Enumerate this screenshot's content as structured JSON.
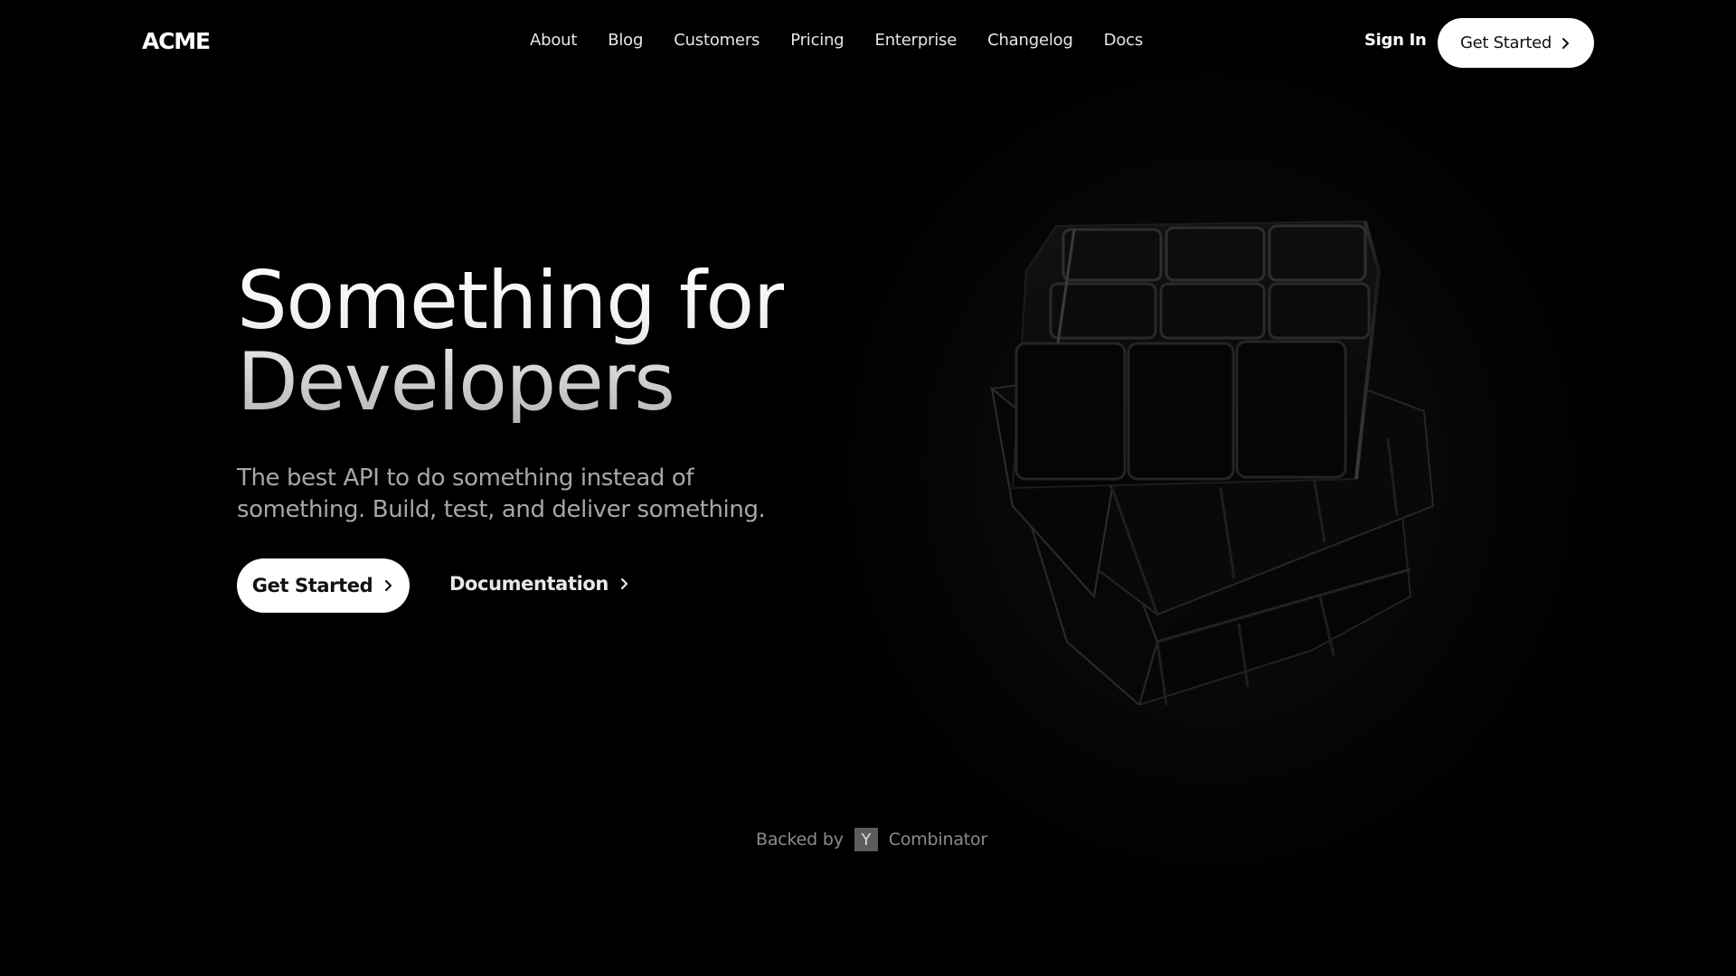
{
  "nav": {
    "logo": "ACME",
    "links": [
      "About",
      "Blog",
      "Customers",
      "Pricing",
      "Enterprise",
      "Changelog",
      "Docs"
    ],
    "sign_in": "Sign In",
    "cta_label": "Get Started",
    "cta_icon": "chevron-right-icon"
  },
  "hero": {
    "title_line1": "Something for",
    "title_line2": "Developers",
    "subtitle_line1": "The best API to do something instead of",
    "subtitle_line2": "something. Build, test, and deliver something.",
    "primary_cta_label": "Get Started",
    "secondary_cta_label": "Documentation",
    "illustration": "dark-rubiks-cube"
  },
  "backed_by": {
    "prefix": "Backed by",
    "badge": "Y",
    "name": "Combinator"
  },
  "colors": {
    "background": "#000000",
    "button_bg": "#ffffff",
    "button_text": "#111111",
    "muted_text": "#a7a7a7",
    "badge_bg": "#5d5d5d"
  }
}
